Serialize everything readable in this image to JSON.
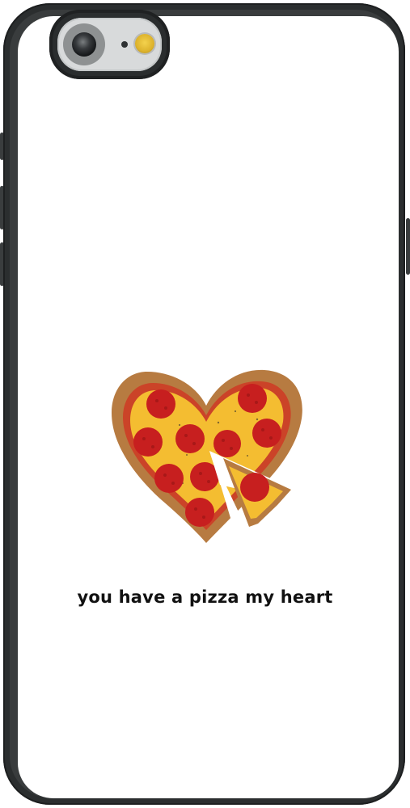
{
  "caption": {
    "text": "you have a pizza my heart"
  },
  "colors": {
    "case": "#2b2e2f",
    "back": "#ffffff",
    "crust": "#b77b41",
    "cheese": "#f4bd31",
    "sauce": "#cb4328",
    "pepperoni": "#c71f1f",
    "flash": "#e8c240"
  },
  "icons": {
    "camera": "camera-lens-icon",
    "flash": "flash-icon"
  }
}
